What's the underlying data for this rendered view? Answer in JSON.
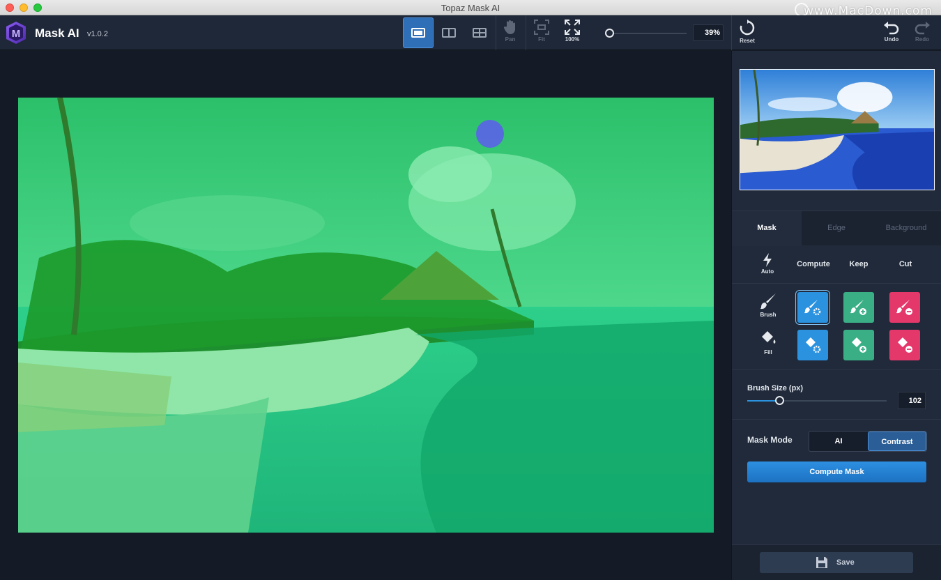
{
  "window": {
    "title": "Topaz Mask AI",
    "watermark": "www.MacDown.com"
  },
  "app": {
    "name": "Mask AI",
    "version": "v1.0.2"
  },
  "toolbar": {
    "view_modes": [
      {
        "icon": "single-view-icon",
        "active": true
      },
      {
        "icon": "split-view-icon",
        "active": false
      },
      {
        "icon": "side-by-side-view-icon",
        "active": false
      }
    ],
    "pan_label": "Pan",
    "fit_label": "Fit",
    "full_label": "100%",
    "zoom_percent": 39,
    "zoom_value": "39%",
    "reset_label": "Reset",
    "undo_label": "Undo",
    "redo_label": "Redo"
  },
  "panel": {
    "tabs": [
      "Mask",
      "Edge",
      "Background"
    ],
    "active_tab": "Mask",
    "actions": {
      "auto_label": "Auto",
      "compute_label": "Compute",
      "keep_label": "Keep",
      "cut_label": "Cut"
    },
    "brush_label": "Brush",
    "fill_label": "Fill",
    "brush_size": {
      "label": "Brush Size (px)",
      "value": "102",
      "fraction": 0.23
    },
    "mask_mode": {
      "label": "Mask Mode",
      "options": [
        "AI",
        "Contrast"
      ],
      "selected": "Contrast"
    },
    "compute_mask_label": "Compute Mask",
    "save_label": "Save"
  },
  "colors": {
    "compute": "#2a92df",
    "keep": "#3aaf86",
    "cut": "#e4386b",
    "accent": "#2e6fb7"
  }
}
